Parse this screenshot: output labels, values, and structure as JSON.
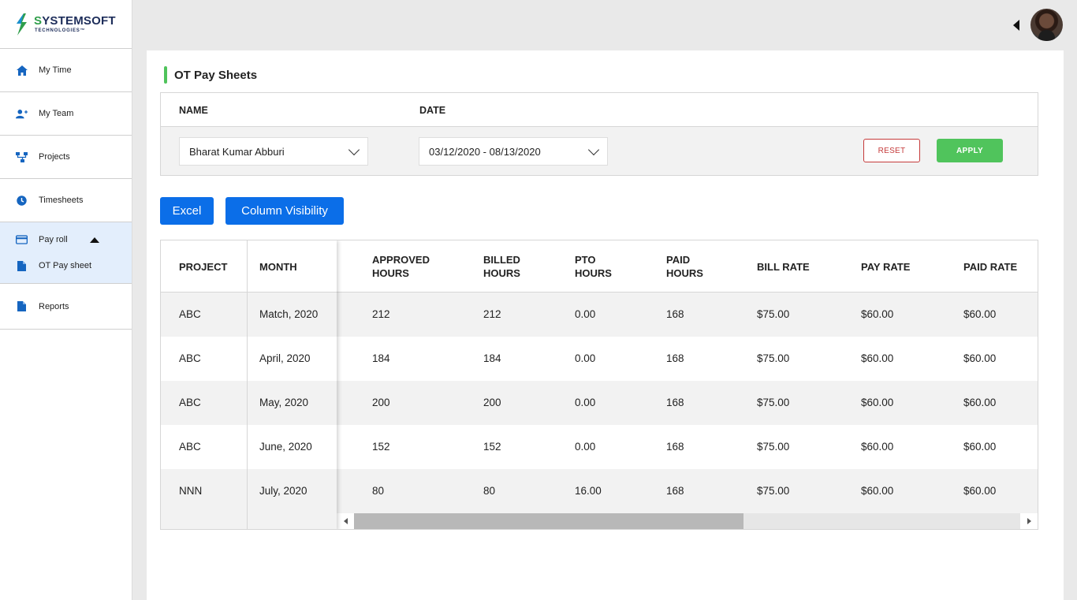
{
  "brand": {
    "name_part1": "S",
    "name_part2": "YSTEMSOFT",
    "tagline": "TECHNOLOGIES™"
  },
  "sidebar": {
    "items": [
      {
        "label": "My Time",
        "icon": "home-icon"
      },
      {
        "label": "My Team",
        "icon": "add-user-icon"
      },
      {
        "label": "Projects",
        "icon": "hierarchy-icon"
      },
      {
        "label": "Timesheets",
        "icon": "clock-icon"
      }
    ],
    "group": {
      "label": "Pay roll",
      "icon": "card-icon",
      "expanded": true,
      "sub_item": {
        "label": "OT Pay sheet",
        "icon": "document-icon"
      }
    },
    "reports": {
      "label": "Reports",
      "icon": "document-icon"
    }
  },
  "page": {
    "title": "OT Pay Sheets"
  },
  "filters": {
    "name_label": "NAME",
    "date_label": "DATE",
    "name_value": "Bharat Kumar Abburi",
    "date_value": "03/12/2020 - 08/13/2020",
    "reset_label": "RESET",
    "apply_label": "APPLY"
  },
  "actions": {
    "excel_label": "Excel",
    "column_visibility_label": "Column Visibility"
  },
  "table": {
    "headers": {
      "project": "PROJECT",
      "month": "MONTH",
      "approved_hours": [
        "APPROVED",
        "HOURS"
      ],
      "billed_hours": [
        "BILLED",
        "HOURS"
      ],
      "pto_hours": [
        "PTO",
        "HOURS"
      ],
      "paid_hours": [
        "PAID",
        "HOURS"
      ],
      "bill_rate": "BILL RATE",
      "pay_rate": "PAY RATE",
      "paid_rate": "PAID RATE"
    },
    "rows": [
      {
        "project": "ABC",
        "month": "Match, 2020",
        "approved": "212",
        "billed": "212",
        "pto": "0.00",
        "paid": "168",
        "bill_rate": "$75.00",
        "pay_rate": "$60.00",
        "paid_rate": "$60.00"
      },
      {
        "project": "ABC",
        "month": "April, 2020",
        "approved": "184",
        "billed": "184",
        "pto": "0.00",
        "paid": "168",
        "bill_rate": "$75.00",
        "pay_rate": "$60.00",
        "paid_rate": "$60.00"
      },
      {
        "project": "ABC",
        "month": "May, 2020",
        "approved": "200",
        "billed": "200",
        "pto": "0.00",
        "paid": "168",
        "bill_rate": "$75.00",
        "pay_rate": "$60.00",
        "paid_rate": "$60.00"
      },
      {
        "project": "ABC",
        "month": "June, 2020",
        "approved": "152",
        "billed": "152",
        "pto": "0.00",
        "paid": "168",
        "bill_rate": "$75.00",
        "pay_rate": "$60.00",
        "paid_rate": "$60.00"
      },
      {
        "project": "NNN",
        "month": "July, 2020",
        "approved": "80",
        "billed": "80",
        "pto": "16.00",
        "paid": "168",
        "bill_rate": "$75.00",
        "pay_rate": "$60.00",
        "paid_rate": "$60.00"
      }
    ]
  },
  "colors": {
    "primary": "#0b6ee8",
    "accent_green": "#50c45c",
    "reset_red": "#c53a3a",
    "sidebar_active": "#e3eefc"
  }
}
